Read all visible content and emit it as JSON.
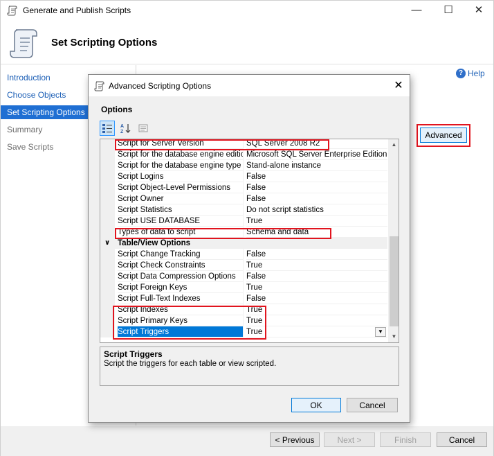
{
  "wizard": {
    "title": "Generate and Publish Scripts",
    "header_title": "Set Scripting Options",
    "nav": [
      {
        "label": "Introduction"
      },
      {
        "label": "Choose Objects"
      },
      {
        "label": "Set Scripting Options"
      },
      {
        "label": "Summary"
      },
      {
        "label": "Save Scripts"
      }
    ],
    "help_label": "Help",
    "advanced_button": "Advanced",
    "footer": {
      "previous": "< Previous",
      "next": "Next >",
      "finish": "Finish",
      "cancel": "Cancel"
    }
  },
  "dialog": {
    "title": "Advanced Scripting Options",
    "options_label": "Options",
    "grid": {
      "rows": [
        {
          "name": "Script for Server Version",
          "value": "SQL Server 2008 R2"
        },
        {
          "name": "Script for the database engine edition",
          "value": "Microsoft SQL Server Enterprise Edition"
        },
        {
          "name": "Script for the database engine type",
          "value": "Stand-alone instance"
        },
        {
          "name": "Script Logins",
          "value": "False"
        },
        {
          "name": "Script Object-Level Permissions",
          "value": "False"
        },
        {
          "name": "Script Owner",
          "value": "False"
        },
        {
          "name": "Script Statistics",
          "value": "Do not script statistics"
        },
        {
          "name": "Script USE DATABASE",
          "value": "True"
        },
        {
          "name": "Types of data to script",
          "value": "Schema and data"
        }
      ],
      "category": "Table/View Options",
      "table_rows": [
        {
          "name": "Script Change Tracking",
          "value": "False"
        },
        {
          "name": "Script Check Constraints",
          "value": "True"
        },
        {
          "name": "Script Data Compression Options",
          "value": "False"
        },
        {
          "name": "Script Foreign Keys",
          "value": "True"
        },
        {
          "name": "Script Full-Text Indexes",
          "value": "False"
        },
        {
          "name": "Script Indexes",
          "value": "True"
        },
        {
          "name": "Script Primary Keys",
          "value": "True"
        },
        {
          "name": "Script Triggers",
          "value": "True"
        }
      ]
    },
    "description": {
      "title": "Script Triggers",
      "text": "Script the triggers for each table or view scripted."
    },
    "ok": "OK",
    "cancel": "Cancel"
  },
  "colors": {
    "highlight": "#e1141e",
    "selection": "#0078d7",
    "link": "#1c5fb6"
  }
}
